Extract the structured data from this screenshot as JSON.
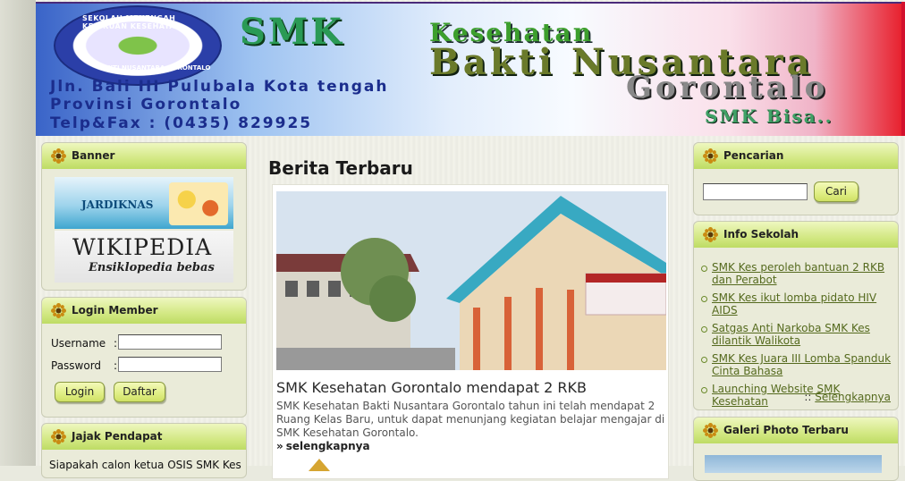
{
  "header": {
    "seal_text_top": "SEKOLAH MENENGAH KEJURUAN KESEHATAN",
    "seal_text_bottom": "BAKTI NUSANTARA GORONTALO",
    "title_line1a": "SMK",
    "title_line1b": "Kesehatan",
    "title_line2": "Bakti Nusantara",
    "title_line3": "Gorontalo",
    "address_line1": "Jln. Bali III Pulubala Kota tengah",
    "address_line2": "Provinsi Gorontalo",
    "address_line3": "Telp&Fax : (0435) 829925",
    "slogan": "SMK Bisa.."
  },
  "left": {
    "banner_box": {
      "title": "Banner",
      "jardiknas_text": "JARDIKNAS",
      "wikipedia_text": "WIKIPEDIA",
      "wikipedia_sub": "Ensiklopedia bebas"
    },
    "login_box": {
      "title": "Login Member",
      "username_label": "Username",
      "password_label": "Password",
      "colon": ":",
      "login_button": "Login",
      "register_button": "Daftar"
    },
    "poll_box": {
      "title": "Jajak Pendapat",
      "question": "Siapakah calon ketua OSIS SMK Kes"
    }
  },
  "center": {
    "section_title": "Berita Terbaru",
    "headline": "SMK Kesehatan Gorontalo mendapat 2 RKB",
    "body": "SMK Kesehatan Bakti Nusantara Gorontalo tahun ini telah mendapat 2 Ruang Kelas Baru, untuk dapat menunjang kegiatan belajar mengajar di SMK Kesehatan Gorontalo.",
    "read_more": "selengkapnya",
    "read_more_arrow": "»"
  },
  "right": {
    "search_box": {
      "title": "Pencarian",
      "search_button": "Cari"
    },
    "info_box": {
      "title": "Info Sekolah",
      "items": [
        "SMK Kes peroleh bantuan 2 RKB dan Perabot",
        "SMK Kes ikut lomba pidato HIV AIDS",
        "Satgas Anti Narkoba SMK Kes dilantik Walikota",
        "SMK Kes Juara III Lomba Spanduk Cinta Bahasa",
        "Launching Website SMK Kesehatan"
      ],
      "more_prefix": "::",
      "more_link": "Selengkapnya"
    },
    "gallery_box": {
      "title": "Galeri Photo Terbaru"
    }
  },
  "colors": {
    "box_head_green": "#d3e884",
    "link_green": "#556a1e",
    "banner_red": "#d3112d"
  }
}
